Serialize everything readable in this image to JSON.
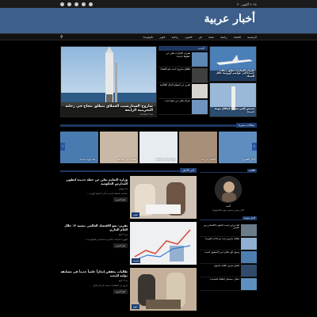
{
  "topbar": {
    "date": "٢٠٢٤ أكتوبر ٣٠"
  },
  "header": {
    "logo": "أخبار عربية"
  },
  "nav": {
    "items": [
      "الرئيسية",
      "اقتصاد",
      "رياضة",
      "صحة",
      "فن",
      "الفنون",
      "رياضة",
      "علوم",
      "تكنولوجيا"
    ]
  },
  "hero": {
    "caption": "صاروخ الستارشيب العملاق ينطلق بنجاح في رحلته التجريبية الرابعة",
    "meta": "منذ ٣ ساعات"
  },
  "side": {
    "header": "أحدث",
    "items": [
      "طيران الإمارات تعلن عن خطوط جديدة",
      "إطلاق صاروخ جديد نحو الفضاء",
      "تقرير عن أسواق المال العالمية",
      "شركة تعلن عن منتج جديد"
    ]
  },
  "feat_right": [
    "طيران الإمارات تطلق رحلات جديدة إلى عواصم أوروبية خلال الشتاء",
    "سبيس إكس تستعد لإطلاق مهمة جديدة"
  ],
  "section1": {
    "label": "مقالات مميزة"
  },
  "strip": [
    "رحلة جوية جديدة",
    "الطلاب في الجامعة",
    "تحليل البيانات المالية",
    "التعليم عن بعد",
    "أخبار الطيران"
  ],
  "section2": {
    "label": "أخر الأخبار"
  },
  "posts": [
    {
      "title": "وزارة التعليم تعلن عن خطة جديدة لتطوير المدارس الحكومية",
      "meta": "منذ يومين",
      "excerpt": "تفاصيل الخطة الجديدة التي أعلنتها الوزارة ...",
      "more": "اقرأ المزيد",
      "badge": "تعليم"
    },
    {
      "title": "تقرير: نمو الاقتصاد العالمي بنسبة ٣٪ خلال العام الجاري",
      "meta": "منذ ٣ أيام",
      "excerpt": "أظهرت البيانات الأخيرة تحسنا في المؤشرات ...",
      "more": "اقرأ المزيد",
      "badge": "اقتصاد"
    },
    {
      "title": "طالبات يحققن إنجازاً علمياً جديداً في مسابقة دولية للبحث",
      "meta": "منذ ٤ أيام",
      "excerpt": "فريق من الطالبات يحصد المركز الأول ...",
      "more": "اقرأ المزيد",
      "badge": "علوم"
    }
  ],
  "aside": {
    "author_head": "الكاتب",
    "author_name": "أحمد",
    "author_bio": "كاتب ومحرر صحفي مهتم بالتكنولوجيا",
    "recent_head": "أخبار منوعة",
    "recent": [
      "لقاء وزاري لبحث التعاون الاقتصادي بين البلدين",
      "إطلاق صاروخ جديد من قاعدة فلوريدا",
      "وصول أول طائرة من الأسطول الجديد",
      "افتتاح معرض الكتاب الدولي",
      "تحليل: مستقبل الطاقة المتجددة"
    ]
  },
  "colors": {
    "brand": "#3d5f8a",
    "accent": "#1e3e73"
  }
}
